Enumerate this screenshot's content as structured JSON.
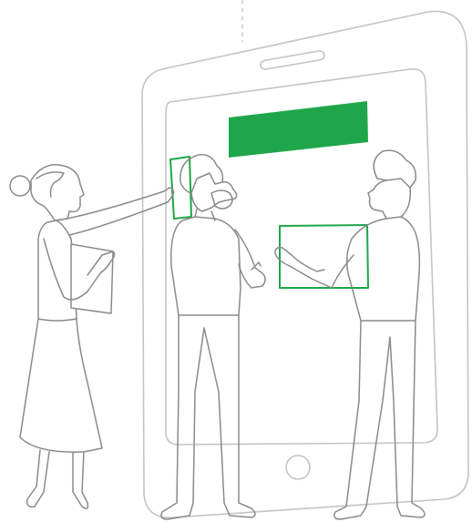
{
  "colors": {
    "line": "#8a8a8a",
    "device_line": "#c4c4c4",
    "dashed_line": "#c9c9c9",
    "accent": "#1fa64a",
    "background": "#ffffff"
  },
  "icons": {
    "device": "tablet-icon",
    "banner": "green-banner-block",
    "card_held": "green-card-frame",
    "card_pinned": "green-card-frame-small"
  }
}
